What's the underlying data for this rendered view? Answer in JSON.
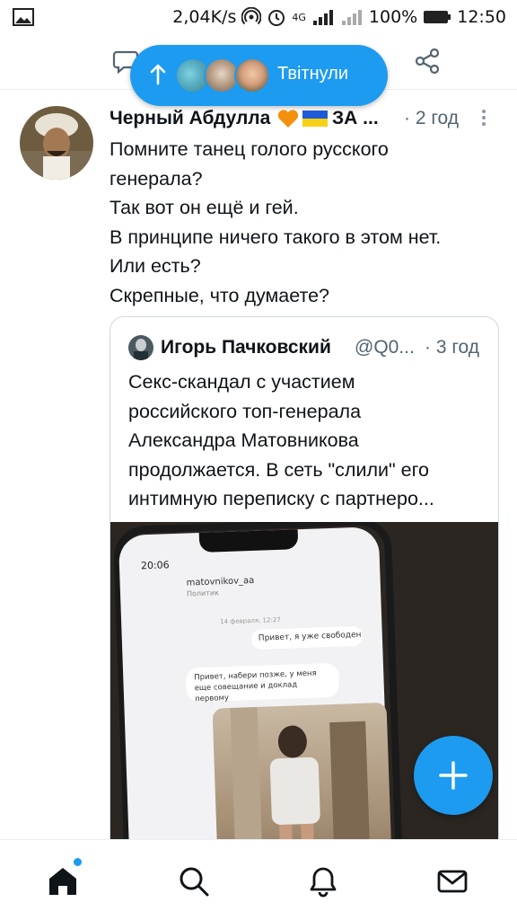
{
  "status_bar": {
    "network_speed": "2,04K/s",
    "network_type": "4G",
    "battery": "100%",
    "time": "12:50"
  },
  "pill": {
    "label": "Твітнули"
  },
  "tweet": {
    "author_name": "Черный Абдулла",
    "author_name_suffix": "ЗА ...",
    "time": "· 2 год",
    "text_lines": [
      "Помните танец голого русского",
      "генерала?",
      "Так вот он ещё и гей.",
      "В принципе ничего такого в этом нет.",
      "Или есть?",
      "Скрепные, что думаете?"
    ]
  },
  "quote": {
    "author_name": "Игорь Пачковский",
    "handle": "@Q0...",
    "time": "· 3 год",
    "text_lines": [
      "Секс-скандал с участием",
      "российского топ-генерала",
      "Александра Матовникова",
      "продолжается. В сеть \"слили\" его",
      "интимную переписку с партнеро..."
    ],
    "media": {
      "phone_time": "20:06",
      "chat_user": "matovnikov_aa",
      "chat_user_sub": "Политик",
      "chat_date": "14 февраля, 12:27",
      "message_out": "Привет, я уже свободен",
      "message_in": "Привет, набери позже, у меня еще совещание и доклад первому"
    }
  },
  "colors": {
    "accent": "#1d9bf0",
    "text_primary": "#0f1419",
    "text_secondary": "#536471",
    "border": "#cfd9de"
  },
  "icons": {
    "top_left": "comment-icon",
    "top_right": "share-icon",
    "fab": "plus-icon",
    "nav": [
      "home-icon",
      "search-icon",
      "notifications-icon",
      "messages-icon"
    ]
  }
}
